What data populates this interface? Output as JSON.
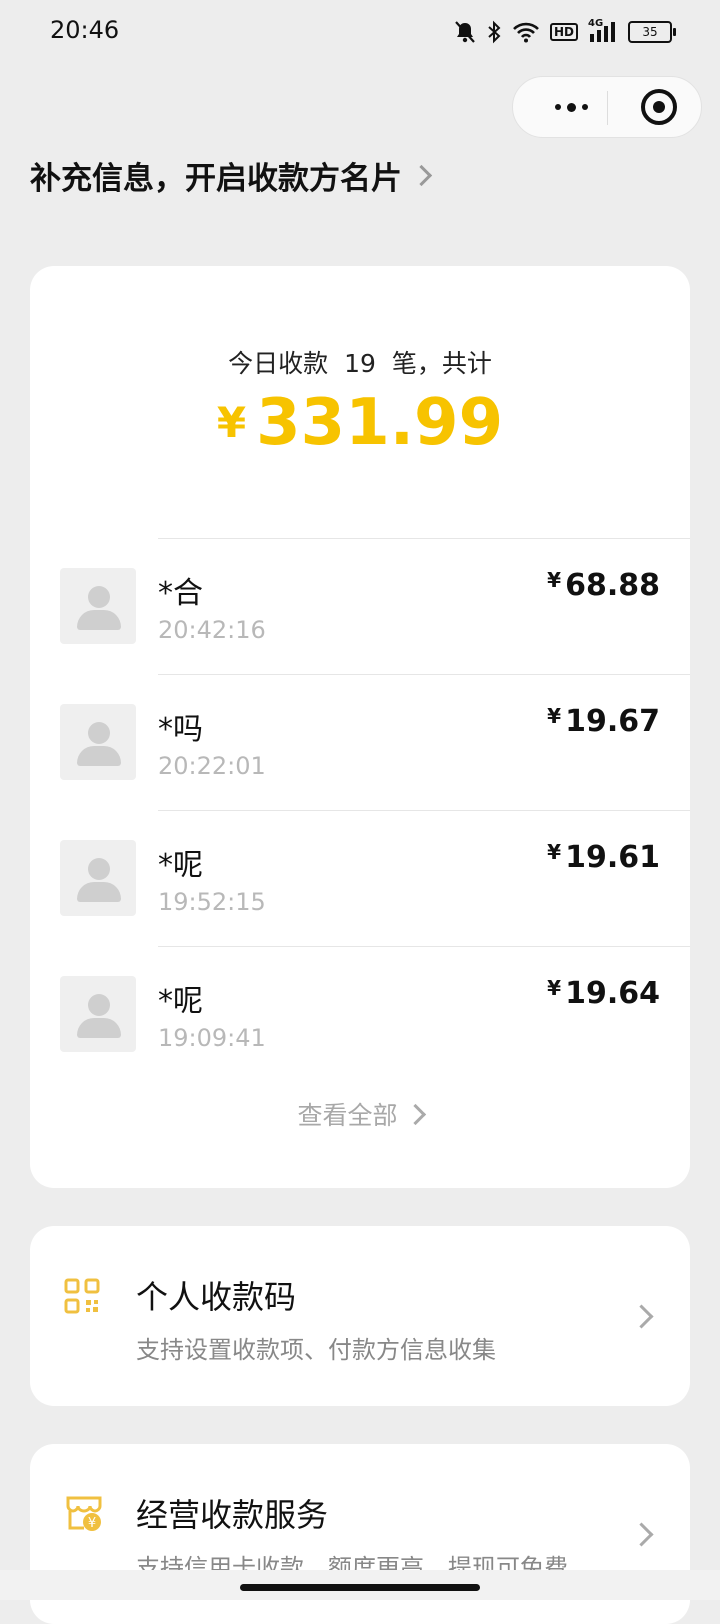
{
  "status_bar": {
    "time": "20:46",
    "icons": [
      "bell-muted-icon",
      "bluetooth-icon",
      "wifi-icon",
      "hd-icon",
      "signal-4g-icon",
      "battery-icon"
    ],
    "hd_label": "HD",
    "network_label": "4G",
    "battery": "35"
  },
  "capsule": {
    "more_icon": "more-dots-icon",
    "close_icon": "target-icon"
  },
  "promo": {
    "text": "补充信息，开启收款方名片"
  },
  "summary": {
    "prefix": "今日收款",
    "count": "19",
    "suffix": "笔，共计",
    "currency": "¥",
    "total": "331.99",
    "accent_color": "#f7c300"
  },
  "transactions": [
    {
      "name": "*合",
      "time": "20:42:16",
      "currency": "¥",
      "amount": "68.88"
    },
    {
      "name": "*吗",
      "time": "20:22:01",
      "currency": "¥",
      "amount": "19.67"
    },
    {
      "name": "*呢",
      "time": "19:52:15",
      "currency": "¥",
      "amount": "19.61"
    },
    {
      "name": "*呢",
      "time": "19:09:41",
      "currency": "¥",
      "amount": "19.64"
    }
  ],
  "view_all": {
    "label": "查看全部"
  },
  "services": [
    {
      "title": "个人收款码",
      "subtitle": "支持设置收款项、付款方信息收集",
      "icon": "qr-code-icon"
    },
    {
      "title": "经营收款服务",
      "subtitle": "支持信用卡收款、额度更高、提现可免费",
      "icon": "shop-yen-icon"
    }
  ]
}
